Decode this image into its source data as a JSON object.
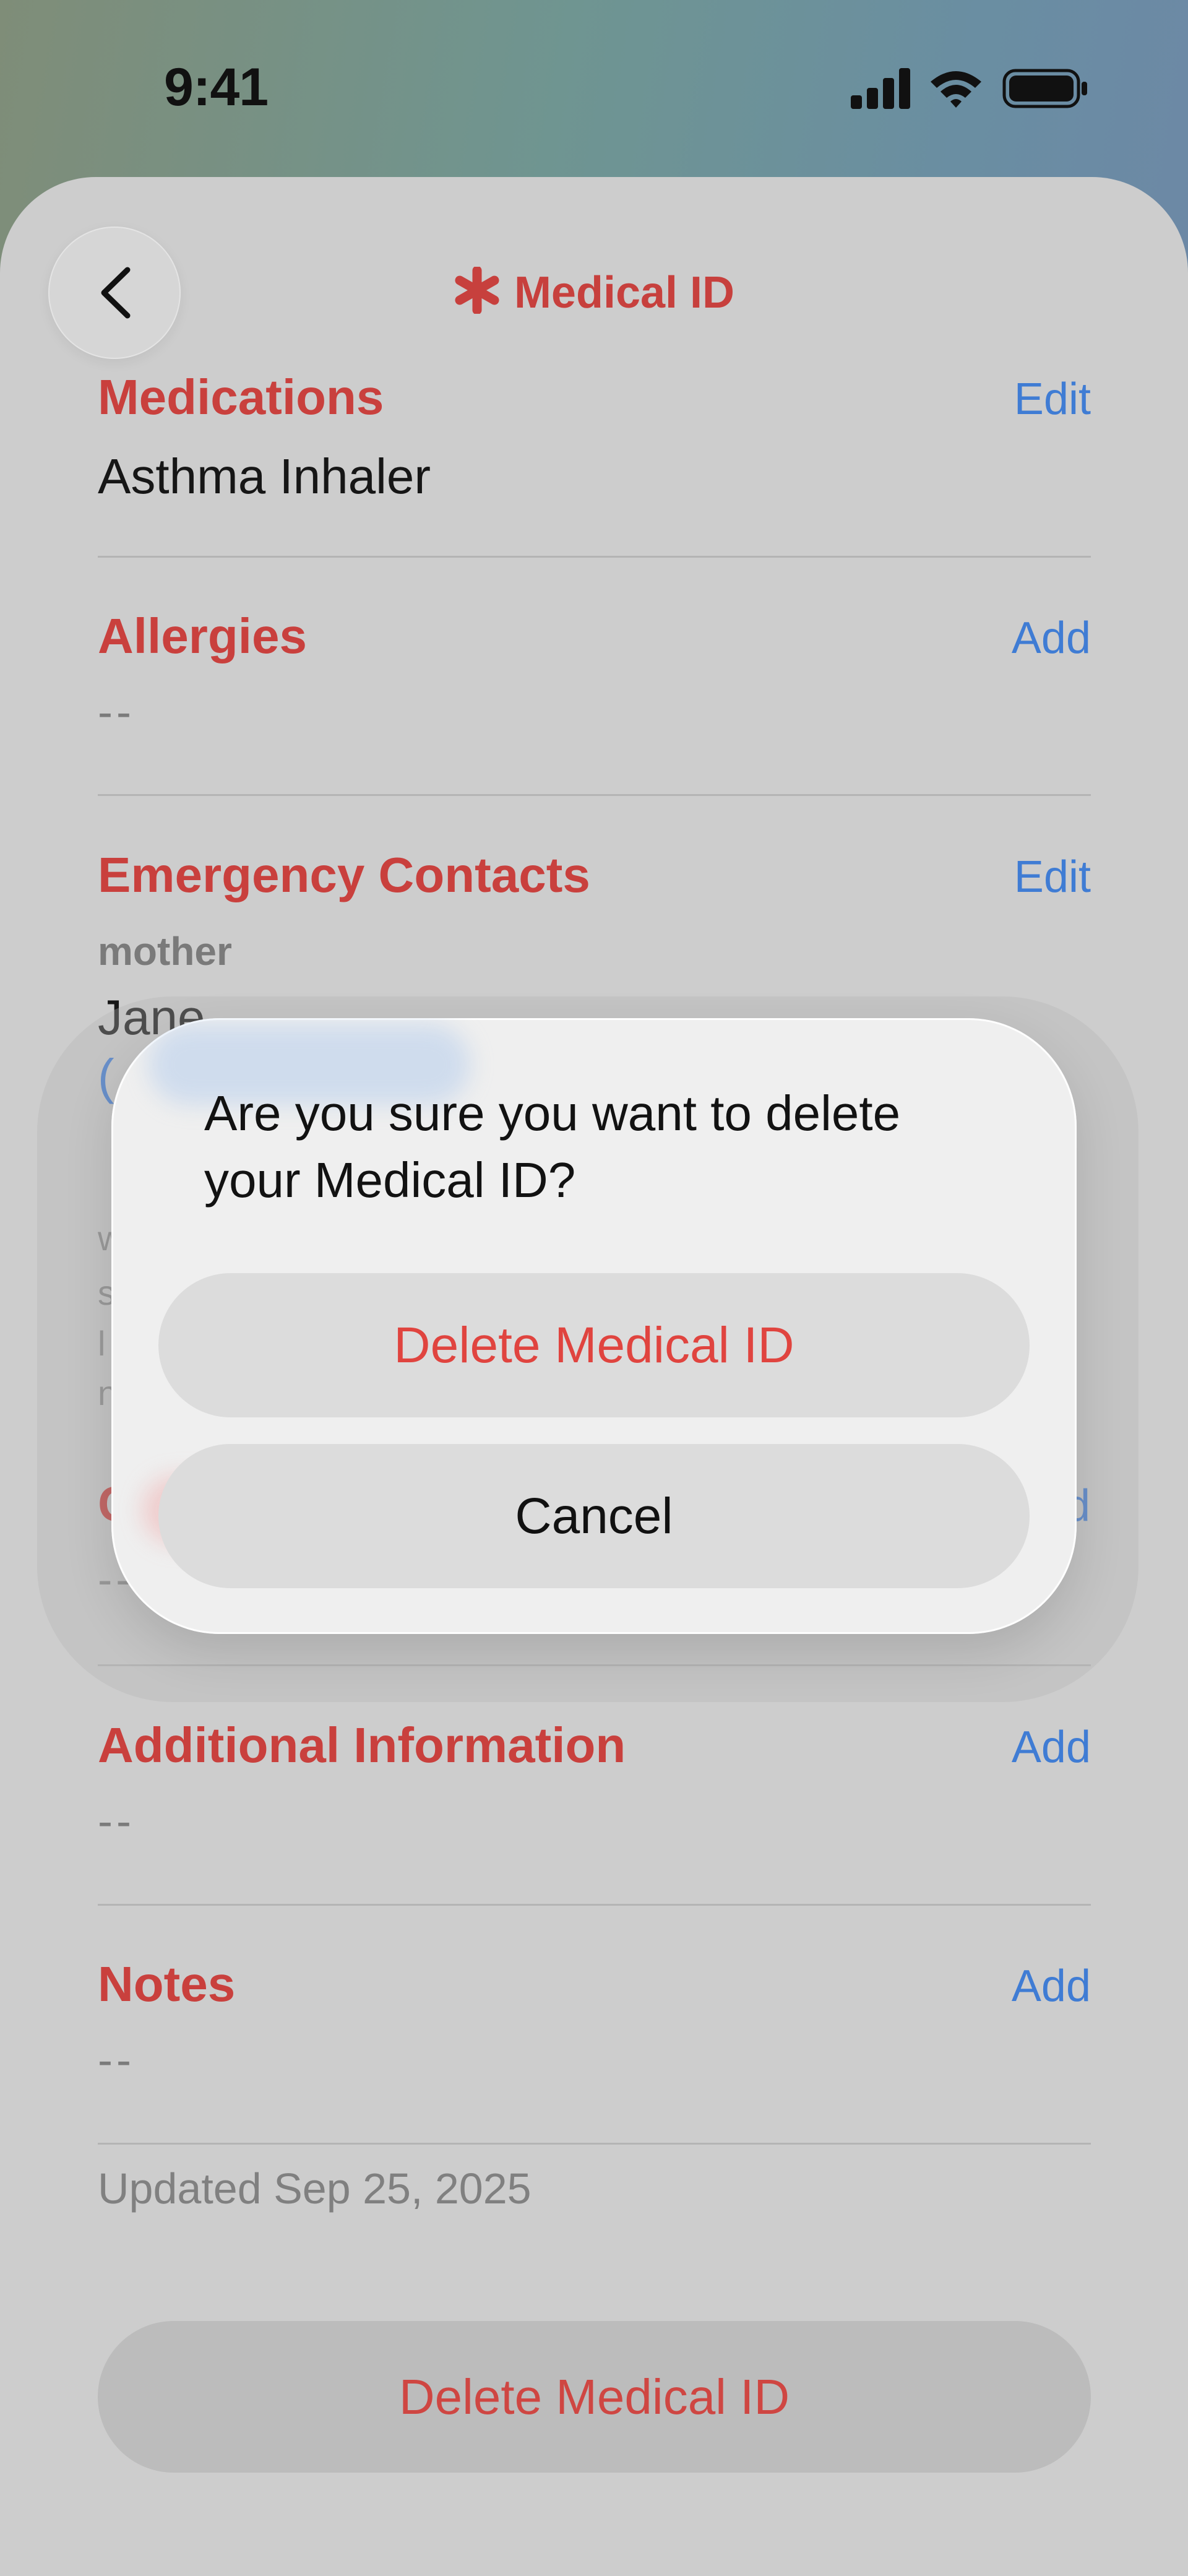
{
  "status_bar": {
    "time": "9:41",
    "icons": [
      "cellular-signal-icon",
      "wifi-icon",
      "battery-icon"
    ]
  },
  "header": {
    "title": "Medical ID",
    "back_icon": "chevron-left-icon",
    "title_icon": "asterisk-icon"
  },
  "colors": {
    "accent_red": "#c9403d",
    "link_blue": "#3f7cd4",
    "destructive_red": "#e0443f"
  },
  "sections": {
    "medications": {
      "label": "Medications",
      "action": "Edit",
      "value": "Asthma Inhaler"
    },
    "allergies": {
      "label": "Allergies",
      "action": "Add",
      "value": "--"
    },
    "emergency_contacts": {
      "label": "Emergency Contacts",
      "action": "Edit",
      "relation": "mother",
      "name_partial": "Jane"
    },
    "additional_information": {
      "label": "Additional Information",
      "action": "Add",
      "value": "--"
    },
    "notes": {
      "label": "Notes",
      "action": "Add",
      "value": "--"
    }
  },
  "obscured_fragments": {
    "phone_paren": "(",
    "line_w": "w",
    "line_s": "s",
    "line_l": "l",
    "line_n": "n",
    "label_c": "C",
    "action_d": "d",
    "value_dash": "--"
  },
  "updated_text": "Updated Sep 25, 2025",
  "bottom_button": "Delete Medical ID",
  "alert": {
    "message": "Are you sure you want to delete your Medical ID?",
    "delete_label": "Delete Medical ID",
    "cancel_label": "Cancel"
  }
}
